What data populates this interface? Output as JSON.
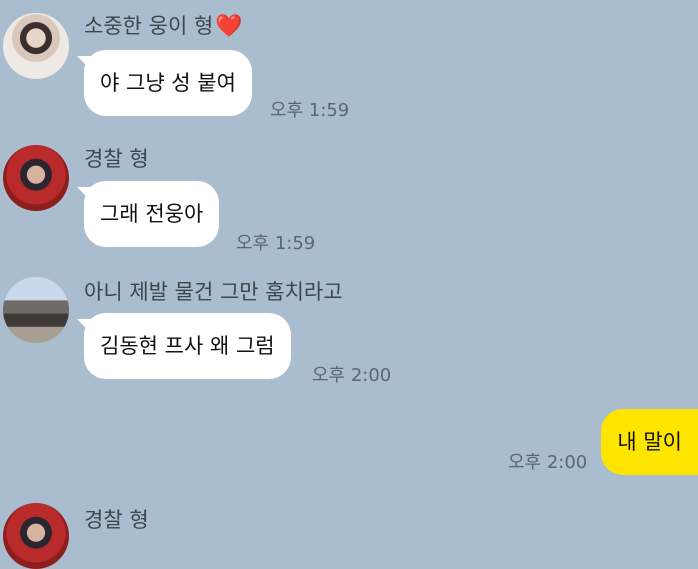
{
  "messages": [
    {
      "sender": "소중한 웅이 형",
      "heart": "❤️",
      "text": "야 그냥 성 붙여",
      "time": "오후 1:59"
    },
    {
      "sender": "경찰 형",
      "text": "그래 전웅아",
      "time": "오후 1:59"
    },
    {
      "sender": "아니 제발 물건 그만 훔치라고",
      "text": "김동현 프사 왜 그럼",
      "time": "오후 2:00"
    },
    {
      "sender": "경찰 형"
    }
  ],
  "my_message": {
    "text": "내 말이",
    "time": "오후 2:00"
  },
  "colors": {
    "background": "#a9bdce",
    "incoming_bubble": "#ffffff",
    "outgoing_bubble": "#fee500"
  }
}
